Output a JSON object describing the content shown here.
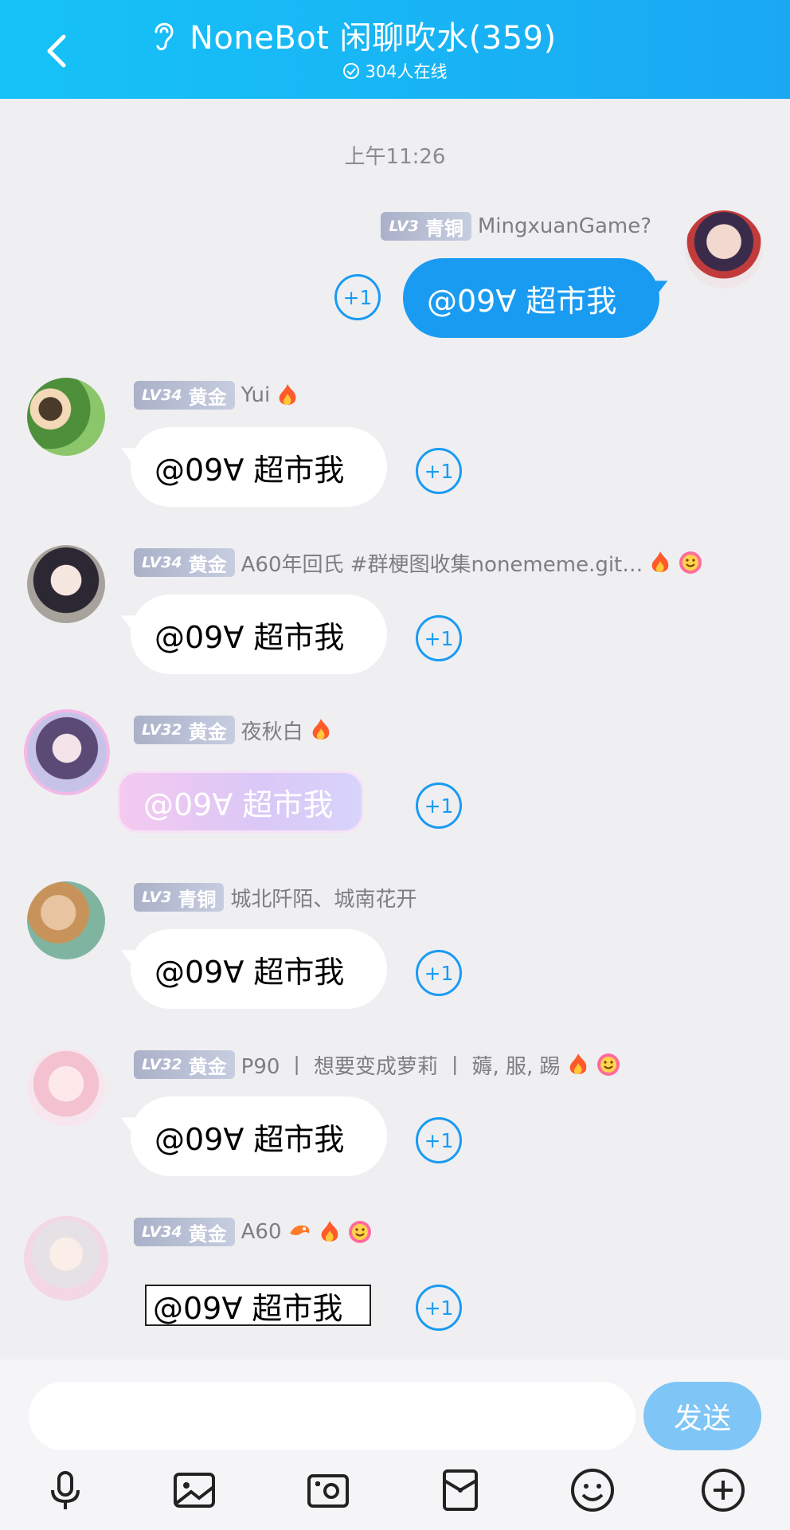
{
  "header": {
    "title": "NoneBot 闲聊吹水(359)",
    "online": "304人在线"
  },
  "timestamp": "上午11:26",
  "messages": [
    {
      "level": "LV3",
      "rank": "青铜",
      "nick": "MingxuanGame?",
      "text": "@09∀ 超市我",
      "plus": "+1",
      "self": true
    },
    {
      "level": "LV34",
      "rank": "黄金",
      "nick": "Yui",
      "text": "@09∀ 超市我",
      "plus": "+1"
    },
    {
      "level": "LV34",
      "rank": "黄金",
      "nick": "A60年回氏 #群梗图收集nonememe.git…",
      "text": "@09∀ 超市我",
      "plus": "+1"
    },
    {
      "level": "LV32",
      "rank": "黄金",
      "nick": "夜秋白",
      "text": "@09∀ 超市我",
      "plus": "+1"
    },
    {
      "level": "LV3",
      "rank": "青铜",
      "nick": "城北阡陌、城南花开",
      "text": "@09∀ 超市我",
      "plus": "+1"
    },
    {
      "level": "LV32",
      "rank": "黄金",
      "nick": "P90 丨 想要变成萝莉 丨 薅, 服, 踢",
      "text": "@09∀ 超市我",
      "plus": "+1"
    },
    {
      "level": "LV34",
      "rank": "黄金",
      "nick": "A60",
      "text": "@09∀ 超市我",
      "plus": "+1"
    }
  ],
  "composer": {
    "placeholder": "",
    "send_label": "发送"
  },
  "icons": [
    "back-icon",
    "ear-icon",
    "check-circle-icon",
    "fire-icon",
    "smile-icon",
    "dragon-icon",
    "microphone-icon",
    "image-icon",
    "camera-icon",
    "red-packet-icon",
    "emoji-icon",
    "plus-icon"
  ],
  "colors": {
    "header": "#16c3f7",
    "accent": "#1a9bf2",
    "send": "#7fc5f6",
    "background": "#efeff2"
  }
}
